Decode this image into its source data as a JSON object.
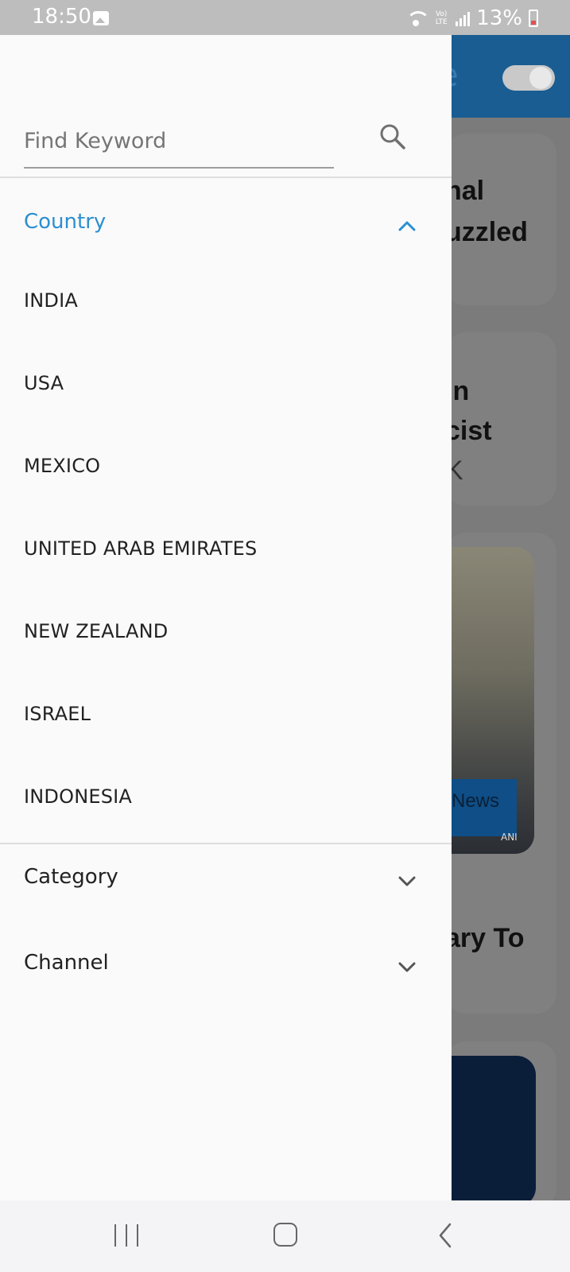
{
  "status_bar": {
    "time": "18:50",
    "battery": "13%",
    "volte_label": "Vo) LTE",
    "icons": [
      "gallery-icon",
      "wifi-icon",
      "volte-icon",
      "signal-icon",
      "battery-icon"
    ]
  },
  "background": {
    "card1_line1": "nal",
    "card1_line2": "uzzled",
    "card2_line1": "In",
    "card2_line2": "cist",
    "card2_line3": "K",
    "photo_tag": "News",
    "photo_source": "ANI",
    "card3_text": "ary To"
  },
  "drawer": {
    "search": {
      "placeholder": "Find Keyword",
      "value": ""
    },
    "sections": {
      "country": {
        "label": "Country",
        "expanded": true,
        "items": [
          "INDIA",
          "USA",
          "MEXICO",
          "UNITED ARAB EMIRATES",
          "NEW ZEALAND",
          "ISRAEL",
          "INDONESIA"
        ]
      },
      "category": {
        "label": "Category",
        "expanded": false
      },
      "channel": {
        "label": "Channel",
        "expanded": false
      }
    }
  },
  "colors": {
    "accent": "#2b8fd1",
    "drawer_bg": "#fafafa",
    "header_bg": "#1a5d92"
  },
  "nav_bar": {
    "buttons": [
      "recent-apps-button",
      "home-button",
      "back-button"
    ]
  }
}
